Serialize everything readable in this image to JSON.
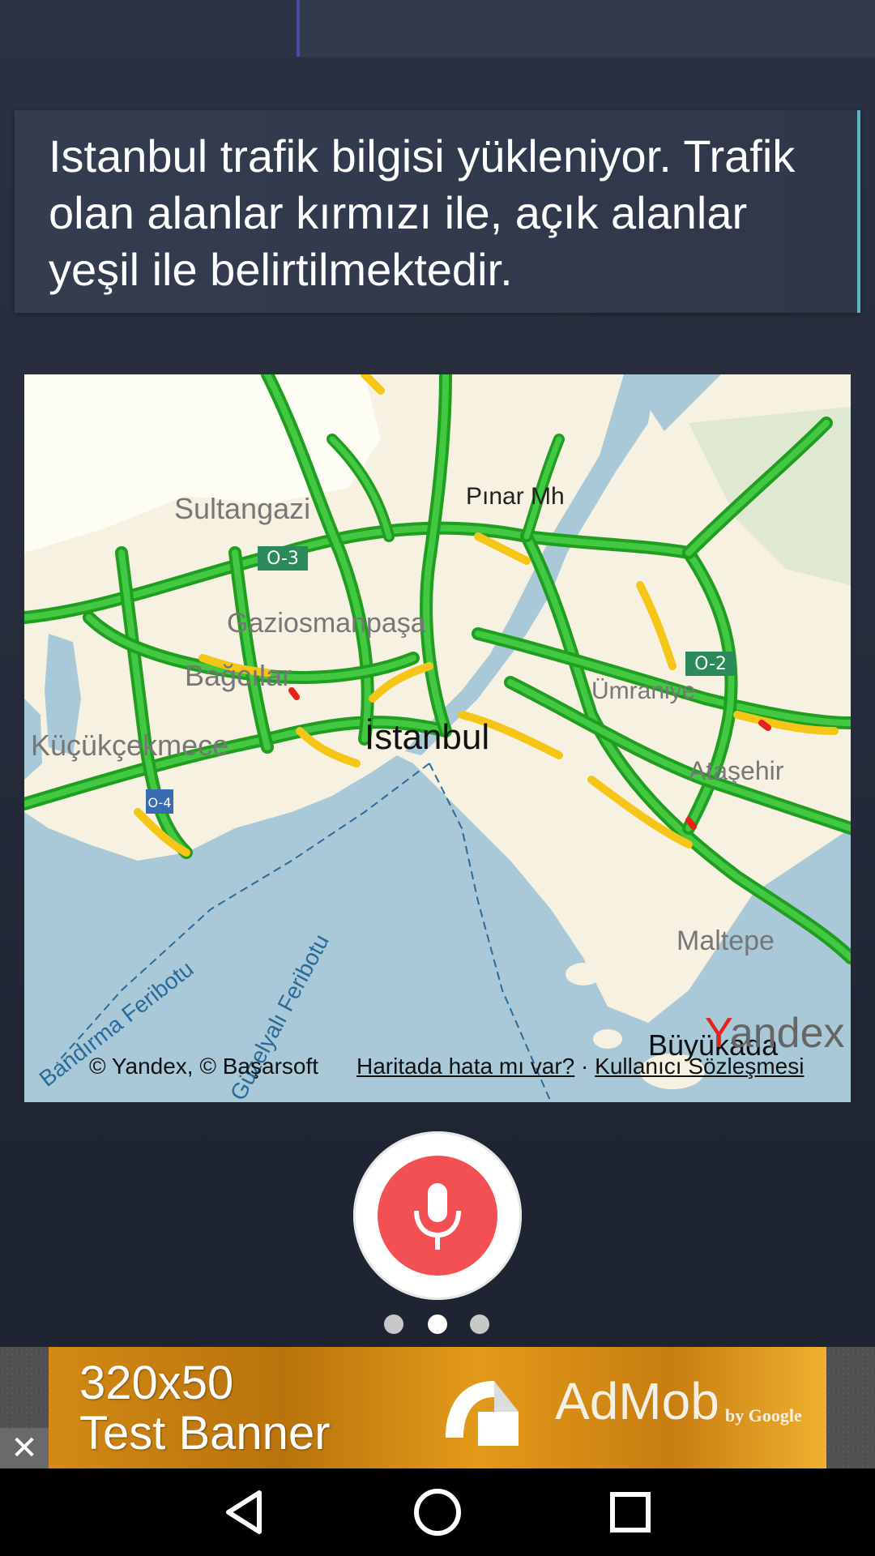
{
  "message": {
    "text": "Istanbul trafik bilgisi yükleniyor. Trafik olan alanlar kırmızı ile, açık alanlar yeşil ile belirtilmektedir."
  },
  "map": {
    "labels": {
      "sultangazi": "Sultangazi",
      "pinar": "Pınar Mh",
      "gaziosman": "Gaziosmanpaşa",
      "bagcilar": "Bağcılar",
      "kucukcekmece": "Küçükçekmece",
      "istanbul": "İstanbul",
      "umraniye": "Ümraniye",
      "atasehir": "Ataşehir",
      "maltepe": "Maltepe",
      "buyukada": "Büyükada",
      "ferry1": "Güzelyalı Feribotu",
      "ferry2": "Bandırma Feribotu",
      "yandex_logo": "Yandex",
      "shield1": "O-3",
      "shield2": "O-2",
      "shield3": "O-4"
    },
    "attribution": "© Yandex, © Başarsoft",
    "link_error": "Haritada hata mı var?",
    "link_separator": " · ",
    "link_terms": "Kullanıcı Sözleşmesi"
  },
  "mic": {
    "icon": "microphone-icon",
    "color": "#f25052"
  },
  "pager": {
    "count": 3,
    "active_index": 1
  },
  "ad": {
    "text_line1": "320x50",
    "text_line2": "Test Banner",
    "brand": "AdMob",
    "brand_sub": "by Google",
    "close": "✕"
  },
  "navigation": {
    "back": "back-icon",
    "home": "home-icon",
    "recents": "recents-icon"
  }
}
